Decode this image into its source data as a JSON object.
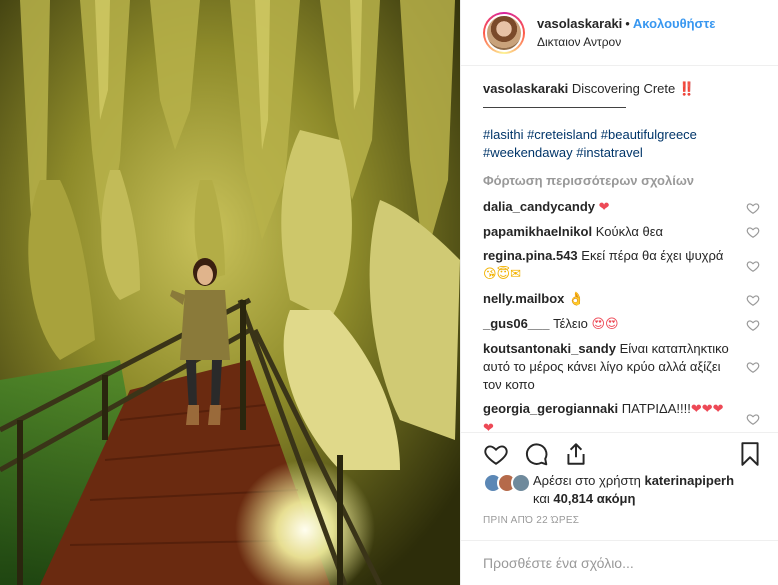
{
  "header": {
    "username": "vasolaskaraki",
    "follow_label": "Ακολουθήστε",
    "location": "Δικταιον Αντρον"
  },
  "caption": {
    "username": "vasolaskaraki",
    "text": "Discovering Crete ‼️",
    "divider": "———————————",
    "hashtags": "#lasithi #creteisland #beautifulgreece #weekendaway #instatravel"
  },
  "load_more_label": "Φόρτωση περισσότερων σχολίων",
  "comments": [
    {
      "user": "dalia_candycandy",
      "text": "",
      "emoji": "❤"
    },
    {
      "user": "papamikhaelnikol",
      "text": "Κούκλα θεα",
      "emoji": ""
    },
    {
      "user": "regina.pina.543",
      "text": "Εκεί πέρα θα έχει ψυχρά",
      "emoji": "😘😇✉"
    },
    {
      "user": "nelly.mailbox",
      "text": "",
      "emoji": "👌"
    },
    {
      "user": "_gus06___",
      "text": "Τέλειο",
      "emoji": "😍😍"
    },
    {
      "user": "koutsantonaki_sandy",
      "text": "Είναι καταπληκτικο αυτό το μέρος κάνει λίγο κρύο αλλά αξίζει τον κοπο",
      "emoji": ""
    },
    {
      "user": "georgia_gerogiannaki",
      "text": "ΠΑΤΡΙΔΑ!!!!",
      "emoji": "❤❤❤❤"
    }
  ],
  "likes": {
    "prefix": "Αρέσει στο χρήστη",
    "user": "katerinapiperh",
    "and": "και",
    "count": "40,814",
    "suffix": "ακόμη"
  },
  "timestamp": "ΠΡΙΝ ΑΠΌ 22 ΏΡΕΣ",
  "add_comment_placeholder": "Προσθέστε ένα σχόλιο...",
  "icons": {
    "like": "heart-icon",
    "comment": "comment-icon",
    "share": "share-icon",
    "save": "bookmark-icon"
  },
  "colors": {
    "follow": "#3897f0",
    "hashtag": "#003569",
    "heart": "#ed4956"
  }
}
